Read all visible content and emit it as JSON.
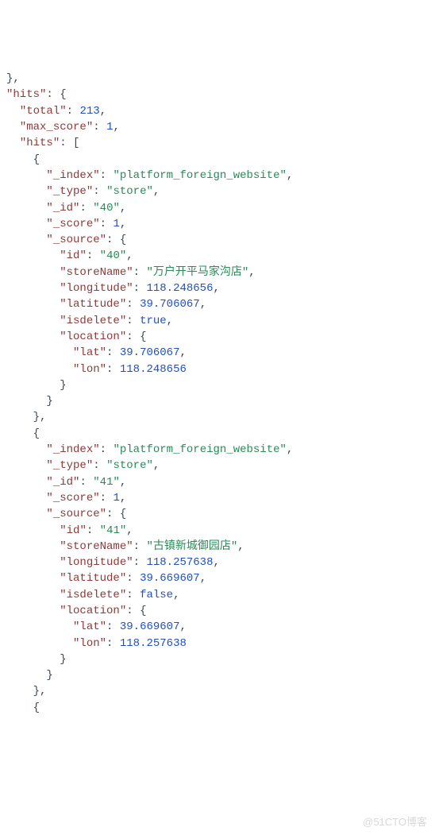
{
  "chart_data": {
    "hits": {
      "total": 213,
      "max_score": 1,
      "hits": [
        {
          "_index": "platform_foreign_website",
          "_type": "store",
          "_id": "40",
          "_score": 1,
          "_source": {
            "id": "40",
            "storeName": "万户开平马家沟店",
            "longitude": 118.248656,
            "latitude": 39.706067,
            "isdelete": true,
            "location": {
              "lat": 39.706067,
              "lon": 118.248656
            }
          }
        },
        {
          "_index": "platform_foreign_website",
          "_type": "store",
          "_id": "41",
          "_score": 1,
          "_source": {
            "id": "41",
            "storeName": "古镇新城御园店",
            "longitude": 118.257638,
            "latitude": 39.669607,
            "isdelete": false,
            "location": {
              "lat": 39.669607,
              "lon": 118.257638
            }
          }
        }
      ]
    }
  },
  "watermark": "@51CTO博客",
  "keys": {
    "hits": "hits",
    "total": "total",
    "max_score": "max_score",
    "_index": "_index",
    "_type": "_type",
    "_id": "_id",
    "_score": "_score",
    "_source": "_source",
    "id": "id",
    "storeName": "storeName",
    "longitude": "longitude",
    "latitude": "latitude",
    "isdelete": "isdelete",
    "location": "location",
    "lat": "lat",
    "lon": "lon"
  }
}
